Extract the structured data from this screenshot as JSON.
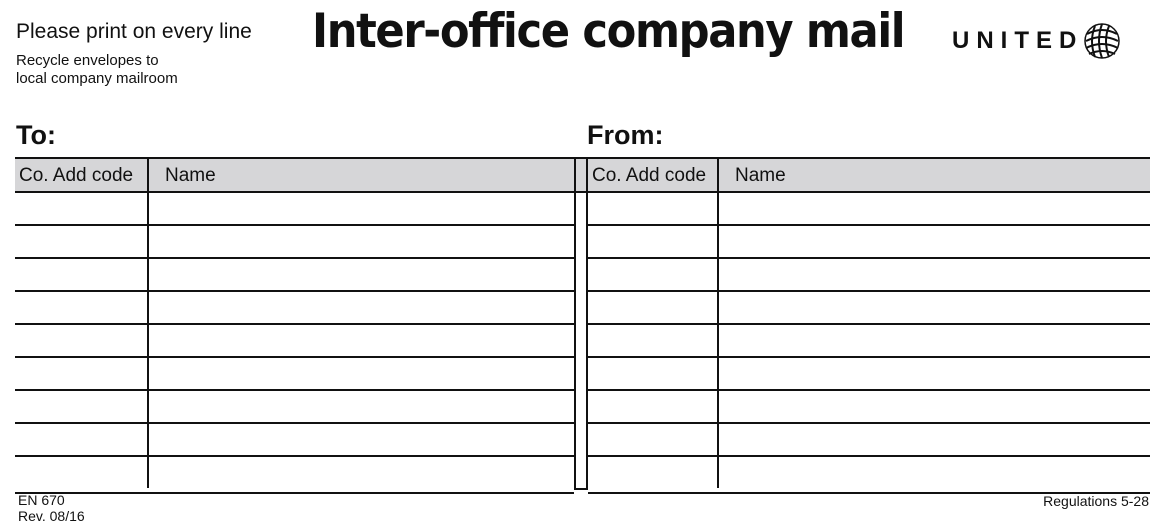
{
  "header": {
    "instruction": "Please print on every line",
    "recycle_line1": "Recycle envelopes to",
    "recycle_line2": "local company mailroom",
    "title": "Inter-office company mail",
    "logo_text": "UNITED"
  },
  "to": {
    "label": "To:",
    "col_code": "Co. Add code",
    "col_name": "Name"
  },
  "from": {
    "label": "From:",
    "col_code": "Co. Add code",
    "col_name": "Name"
  },
  "blank_rows": 9,
  "footer": {
    "form_number": "EN 670",
    "revision": "Rev. 08/16",
    "regulations": "Regulations 5-28"
  },
  "icons": {
    "logo": "united-globe-icon"
  },
  "colors": {
    "header_fill": "#d6d6d8",
    "rule": "#111111"
  }
}
